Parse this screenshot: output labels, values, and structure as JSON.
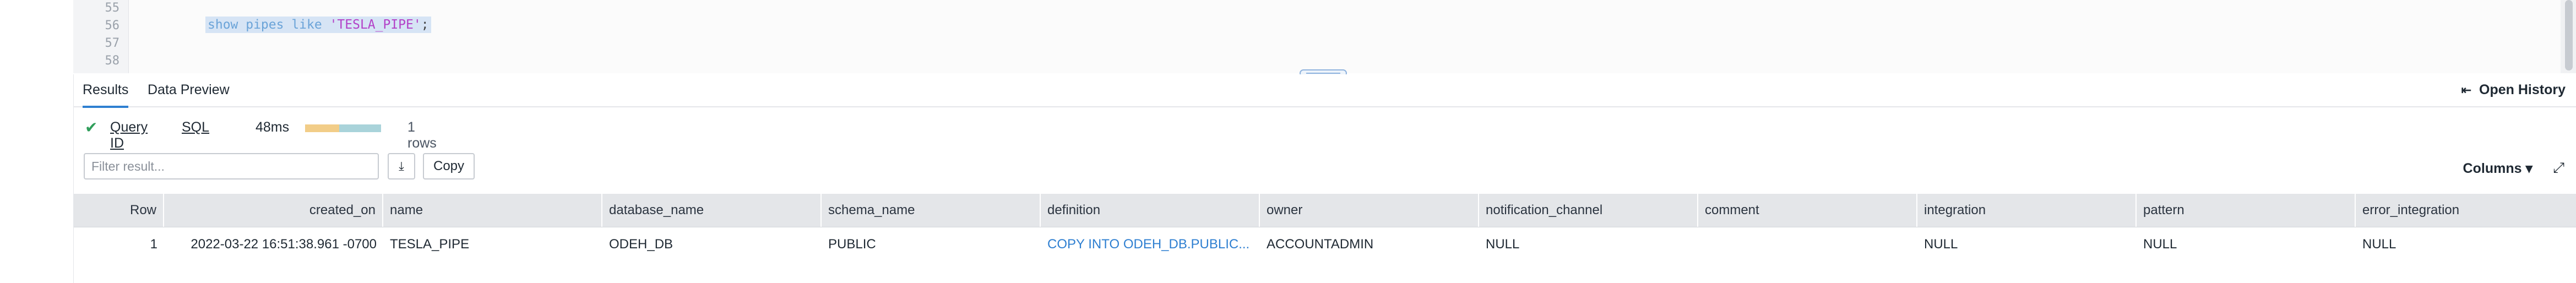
{
  "editor": {
    "line_numbers": [
      "55",
      "56",
      "57",
      "58"
    ],
    "code_keyword": "show pipes like ",
    "code_string": "'TESLA_PIPE'",
    "code_end": ";"
  },
  "results": {
    "tabs": [
      {
        "label": "Results",
        "active": true
      },
      {
        "label": "Data Preview",
        "active": false
      }
    ],
    "open_history_label": "Open History",
    "query_id_label": "Query ID",
    "sql_label": "SQL",
    "duration": "48ms",
    "duration_bar_fraction": 0.45,
    "row_count": "1 rows",
    "filter_placeholder": "Filter result...",
    "copy_label": "Copy",
    "columns_label": "Columns ▾",
    "colors": {
      "accent": "#2e7fd1",
      "success": "#2f9e5a",
      "bar_compile": "#f2cd88",
      "bar_exec": "#a9d3da"
    }
  },
  "table": {
    "headers": [
      "Row",
      "created_on",
      "name",
      "database_name",
      "schema_name",
      "definition",
      "owner",
      "notification_channel",
      "comment",
      "integration",
      "pattern",
      "error_integration"
    ],
    "rows": [
      [
        "1",
        "2022-03-22 16:51:38.961 -0700",
        "TESLA_PIPE",
        "ODEH_DB",
        "PUBLIC",
        "COPY INTO ODEH_DB.PUBLIC...",
        "ACCOUNTADMIN",
        "NULL",
        "",
        "NULL",
        "NULL",
        "NULL"
      ]
    ]
  }
}
